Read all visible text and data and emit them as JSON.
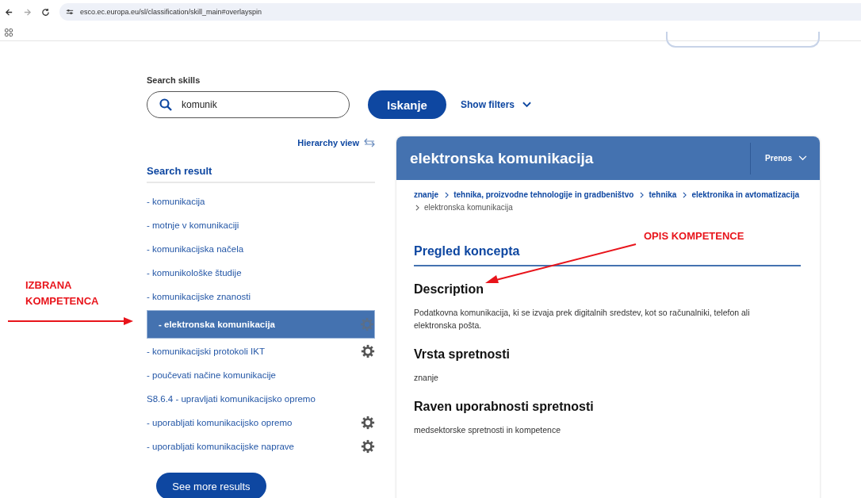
{
  "browser": {
    "url": "esco.ec.europa.eu/sl/classification/skill_main#overlayspin"
  },
  "search": {
    "label": "Search skills",
    "value": "komunik",
    "button": "Iskanje",
    "filters": "Show filters"
  },
  "hierarchy_link": "Hierarchy view",
  "results": {
    "heading": "Search result",
    "items": [
      {
        "label": "- komunikacija",
        "selected": false,
        "gear": false
      },
      {
        "label": "- motnje v komunikaciji",
        "selected": false,
        "gear": false
      },
      {
        "label": "- komunikacijska načela",
        "selected": false,
        "gear": false
      },
      {
        "label": "- komunikološke študije",
        "selected": false,
        "gear": false
      },
      {
        "label": "- komunikacijske znanosti",
        "selected": false,
        "gear": false
      },
      {
        "label": "- elektronska komunikacija",
        "selected": true,
        "gear": true
      },
      {
        "label": "- komunikacijski protokoli IKT",
        "selected": false,
        "gear": true
      },
      {
        "label": "- poučevati načine komunikacije",
        "selected": false,
        "gear": false
      },
      {
        "label": "S8.6.4 - upravljati komunikacijsko opremo",
        "selected": false,
        "gear": false
      },
      {
        "label": "- uporabljati komunikacijsko opremo",
        "selected": false,
        "gear": true
      },
      {
        "label": "- uporabljati komunikacijske naprave",
        "selected": false,
        "gear": true
      }
    ],
    "more_button": "See more results"
  },
  "detail": {
    "title": "elektronska komunikacija",
    "download": "Prenos",
    "breadcrumb": [
      "znanje",
      "tehnika, proizvodne tehnologije in gradbeništvo",
      "tehnika",
      "elektronika in avtomatizacija",
      "elektronska komunikacija"
    ],
    "section": "Pregled koncepta",
    "fields": [
      {
        "heading": "Description",
        "text": "Podatkovna komunikacija, ki se izvaja prek digitalnih sredstev, kot so računalniki, telefon ali elektronska pošta."
      },
      {
        "heading": "Vrsta spretnosti",
        "text": "znanje"
      },
      {
        "heading": "Raven uporabnosti spretnosti",
        "text": "medsektorske spretnosti in kompetence"
      }
    ]
  },
  "annotations": [
    {
      "text": "IZBRANA KOMPETENCA"
    },
    {
      "text": "OPIS KOMPETENCE"
    }
  ]
}
